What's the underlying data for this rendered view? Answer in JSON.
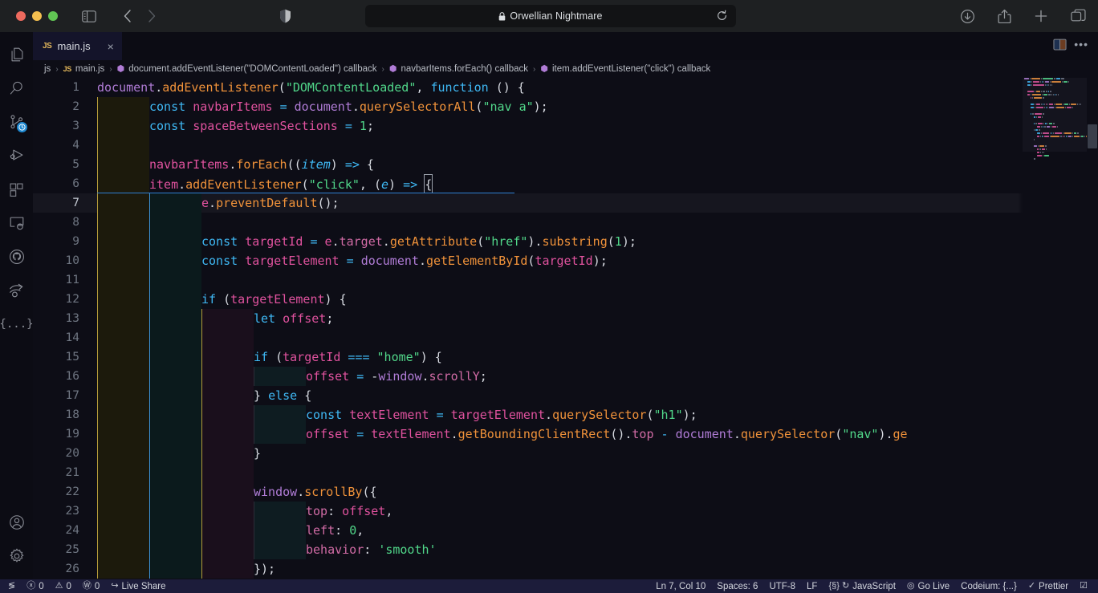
{
  "browser": {
    "title": "Orwellian Nightmare",
    "lock_icon": "lock-icon",
    "traffic_lights": [
      "close",
      "minimize",
      "zoom"
    ],
    "toolbar": {
      "sidebar": "sidebar-toggle-icon",
      "back": "chevron-left-icon",
      "forward": "chevron-right-icon",
      "shield": "privacy-shield-icon",
      "reload": "reload-icon",
      "downloads": "download-icon",
      "share": "share-icon",
      "new_tab": "plus-icon",
      "tab_overview": "tabs-icon"
    }
  },
  "activity_bar": {
    "items": [
      {
        "name": "explorer-icon",
        "label": "Explorer"
      },
      {
        "name": "search-icon",
        "label": "Search"
      },
      {
        "name": "source-control-icon",
        "label": "Source Control",
        "badge": "clock-badge"
      },
      {
        "name": "run-and-debug-icon",
        "label": "Run and Debug"
      },
      {
        "name": "extensions-icon",
        "label": "Extensions"
      },
      {
        "name": "remote-explorer-icon",
        "label": "Remote Explorer"
      },
      {
        "name": "github-icon",
        "label": "GitHub"
      },
      {
        "name": "live-share-icon",
        "label": "Live Share"
      },
      {
        "name": "codeium-icon",
        "label": "{...}"
      }
    ],
    "bottom_items": [
      {
        "name": "account-icon",
        "label": "Accounts"
      },
      {
        "name": "settings-gear-icon",
        "label": "Manage"
      }
    ]
  },
  "tabs": [
    {
      "label": "main.js",
      "icon": "JS",
      "close": "×",
      "active": true
    }
  ],
  "editor_actions": {
    "split": "split-editor-icon",
    "more": "•••"
  },
  "breadcrumb": {
    "items": [
      {
        "label": "js",
        "icon": null
      },
      {
        "label": "main.js",
        "icon": "JS"
      },
      {
        "label": "document.addEventListener(\"DOMContentLoaded\") callback",
        "icon": "symbol"
      },
      {
        "label": "navbarItems.forEach() callback",
        "icon": "symbol"
      },
      {
        "label": "item.addEventListener(\"click\") callback",
        "icon": "symbol"
      }
    ],
    "separator": "›"
  },
  "code": {
    "language": "JavaScript",
    "current_line": 7,
    "lines": [
      {
        "n": 1,
        "indent": 0,
        "tokens": [
          [
            "t-obj",
            "document"
          ],
          [
            "t-punc",
            "."
          ],
          [
            "t-fn",
            "addEventListener"
          ],
          [
            "t-punc",
            "("
          ],
          [
            "t-str",
            "\"DOMContentLoaded\""
          ],
          [
            "t-punc",
            ", "
          ],
          [
            "t-kw",
            "function"
          ],
          [
            "t-punc",
            " () {"
          ]
        ]
      },
      {
        "n": 2,
        "indent": 1,
        "tokens": [
          [
            "t-kw",
            "const"
          ],
          [
            "t-punc",
            " "
          ],
          [
            "t-var",
            "navbarItems"
          ],
          [
            "t-punc",
            " "
          ],
          [
            "t-op",
            "="
          ],
          [
            "t-punc",
            " "
          ],
          [
            "t-obj",
            "document"
          ],
          [
            "t-punc",
            "."
          ],
          [
            "t-fn",
            "querySelectorAll"
          ],
          [
            "t-punc",
            "("
          ],
          [
            "t-str",
            "\"nav a\""
          ],
          [
            "t-punc",
            ");"
          ]
        ]
      },
      {
        "n": 3,
        "indent": 1,
        "tokens": [
          [
            "t-kw",
            "const"
          ],
          [
            "t-punc",
            " "
          ],
          [
            "t-var",
            "spaceBetweenSections"
          ],
          [
            "t-punc",
            " "
          ],
          [
            "t-op",
            "="
          ],
          [
            "t-punc",
            " "
          ],
          [
            "t-num",
            "1"
          ],
          [
            "t-punc",
            ";"
          ]
        ]
      },
      {
        "n": 4,
        "indent": 1,
        "tokens": []
      },
      {
        "n": 5,
        "indent": 1,
        "tokens": [
          [
            "t-var",
            "navbarItems"
          ],
          [
            "t-punc",
            "."
          ],
          [
            "t-fn",
            "forEach"
          ],
          [
            "t-punc",
            "(("
          ],
          [
            "t-par",
            "item"
          ],
          [
            "t-punc",
            ") "
          ],
          [
            "t-op",
            "=>"
          ],
          [
            "t-punc",
            " {"
          ]
        ]
      },
      {
        "n": 6,
        "indent": 1,
        "tokens": [
          [
            "t-var",
            "item"
          ],
          [
            "t-punc",
            "."
          ],
          [
            "t-fn",
            "addEventListener"
          ],
          [
            "t-punc",
            "("
          ],
          [
            "t-str",
            "\"click\""
          ],
          [
            "t-punc",
            ", ("
          ],
          [
            "t-par",
            "e"
          ],
          [
            "t-punc",
            ") "
          ],
          [
            "t-op",
            "=>"
          ],
          [
            "t-punc",
            " "
          ],
          [
            "t-cursor",
            "{"
          ]
        ]
      },
      {
        "n": 7,
        "indent": 2,
        "tokens": [
          [
            "t-var",
            "e"
          ],
          [
            "t-punc",
            "."
          ],
          [
            "t-fn",
            "preventDefault"
          ],
          [
            "t-punc",
            "();"
          ]
        ]
      },
      {
        "n": 8,
        "indent": 2,
        "tokens": []
      },
      {
        "n": 9,
        "indent": 2,
        "tokens": [
          [
            "t-kw",
            "const"
          ],
          [
            "t-punc",
            " "
          ],
          [
            "t-var",
            "targetId"
          ],
          [
            "t-punc",
            " "
          ],
          [
            "t-op",
            "="
          ],
          [
            "t-punc",
            " "
          ],
          [
            "t-var",
            "e"
          ],
          [
            "t-punc",
            "."
          ],
          [
            "t-prop",
            "target"
          ],
          [
            "t-punc",
            "."
          ],
          [
            "t-fn",
            "getAttribute"
          ],
          [
            "t-punc",
            "("
          ],
          [
            "t-str",
            "\"href\""
          ],
          [
            "t-punc",
            ")."
          ],
          [
            "t-fn",
            "substring"
          ],
          [
            "t-punc",
            "("
          ],
          [
            "t-num",
            "1"
          ],
          [
            "t-punc",
            ");"
          ]
        ]
      },
      {
        "n": 10,
        "indent": 2,
        "tokens": [
          [
            "t-kw",
            "const"
          ],
          [
            "t-punc",
            " "
          ],
          [
            "t-var",
            "targetElement"
          ],
          [
            "t-punc",
            " "
          ],
          [
            "t-op",
            "="
          ],
          [
            "t-punc",
            " "
          ],
          [
            "t-obj",
            "document"
          ],
          [
            "t-punc",
            "."
          ],
          [
            "t-fn",
            "getElementById"
          ],
          [
            "t-punc",
            "("
          ],
          [
            "t-var",
            "targetId"
          ],
          [
            "t-punc",
            ");"
          ]
        ]
      },
      {
        "n": 11,
        "indent": 2,
        "tokens": []
      },
      {
        "n": 12,
        "indent": 2,
        "tokens": [
          [
            "t-kw",
            "if"
          ],
          [
            "t-punc",
            " ("
          ],
          [
            "t-var",
            "targetElement"
          ],
          [
            "t-punc",
            ") {"
          ]
        ]
      },
      {
        "n": 13,
        "indent": 3,
        "tokens": [
          [
            "t-kw",
            "let"
          ],
          [
            "t-punc",
            " "
          ],
          [
            "t-var",
            "offset"
          ],
          [
            "t-punc",
            ";"
          ]
        ]
      },
      {
        "n": 14,
        "indent": 3,
        "tokens": []
      },
      {
        "n": 15,
        "indent": 3,
        "tokens": [
          [
            "t-kw",
            "if"
          ],
          [
            "t-punc",
            " ("
          ],
          [
            "t-var",
            "targetId"
          ],
          [
            "t-punc",
            " "
          ],
          [
            "t-op",
            "==="
          ],
          [
            "t-punc",
            " "
          ],
          [
            "t-str",
            "\"home\""
          ],
          [
            "t-punc",
            ") {"
          ]
        ]
      },
      {
        "n": 16,
        "indent": 4,
        "tokens": [
          [
            "t-var",
            "offset"
          ],
          [
            "t-punc",
            " "
          ],
          [
            "t-op",
            "="
          ],
          [
            "t-punc",
            " -"
          ],
          [
            "t-obj",
            "window"
          ],
          [
            "t-punc",
            "."
          ],
          [
            "t-prop",
            "scrollY"
          ],
          [
            "t-punc",
            ";"
          ]
        ]
      },
      {
        "n": 17,
        "indent": 3,
        "tokens": [
          [
            "t-punc",
            "} "
          ],
          [
            "t-kw",
            "else"
          ],
          [
            "t-punc",
            " {"
          ]
        ]
      },
      {
        "n": 18,
        "indent": 4,
        "tokens": [
          [
            "t-kw",
            "const"
          ],
          [
            "t-punc",
            " "
          ],
          [
            "t-var",
            "textElement"
          ],
          [
            "t-punc",
            " "
          ],
          [
            "t-op",
            "="
          ],
          [
            "t-punc",
            " "
          ],
          [
            "t-var",
            "targetElement"
          ],
          [
            "t-punc",
            "."
          ],
          [
            "t-fn",
            "querySelector"
          ],
          [
            "t-punc",
            "("
          ],
          [
            "t-str",
            "\"h1\""
          ],
          [
            "t-punc",
            ");"
          ]
        ]
      },
      {
        "n": 19,
        "indent": 4,
        "tokens": [
          [
            "t-var",
            "offset"
          ],
          [
            "t-punc",
            " "
          ],
          [
            "t-op",
            "="
          ],
          [
            "t-punc",
            " "
          ],
          [
            "t-var",
            "textElement"
          ],
          [
            "t-punc",
            "."
          ],
          [
            "t-fn",
            "getBoundingClientRect"
          ],
          [
            "t-punc",
            "()."
          ],
          [
            "t-prop",
            "top"
          ],
          [
            "t-punc",
            " "
          ],
          [
            "t-op",
            "-"
          ],
          [
            "t-punc",
            " "
          ],
          [
            "t-obj",
            "document"
          ],
          [
            "t-punc",
            "."
          ],
          [
            "t-fn",
            "querySelector"
          ],
          [
            "t-punc",
            "("
          ],
          [
            "t-str",
            "\"nav\""
          ],
          [
            "t-punc",
            ")."
          ],
          [
            "t-fn",
            "ge"
          ]
        ]
      },
      {
        "n": 20,
        "indent": 3,
        "tokens": [
          [
            "t-punc",
            "}"
          ]
        ]
      },
      {
        "n": 21,
        "indent": 3,
        "tokens": []
      },
      {
        "n": 22,
        "indent": 3,
        "tokens": [
          [
            "t-obj",
            "window"
          ],
          [
            "t-punc",
            "."
          ],
          [
            "t-fn",
            "scrollBy"
          ],
          [
            "t-punc",
            "({"
          ]
        ]
      },
      {
        "n": 23,
        "indent": 4,
        "tokens": [
          [
            "t-prop",
            "top"
          ],
          [
            "t-punc",
            ": "
          ],
          [
            "t-var",
            "offset"
          ],
          [
            "t-punc",
            ","
          ]
        ]
      },
      {
        "n": 24,
        "indent": 4,
        "tokens": [
          [
            "t-prop",
            "left"
          ],
          [
            "t-punc",
            ": "
          ],
          [
            "t-num",
            "0"
          ],
          [
            "t-punc",
            ","
          ]
        ]
      },
      {
        "n": 25,
        "indent": 4,
        "tokens": [
          [
            "t-prop",
            "behavior"
          ],
          [
            "t-punc",
            ": "
          ],
          [
            "t-str",
            "'smooth'"
          ]
        ]
      },
      {
        "n": 26,
        "indent": 3,
        "tokens": [
          [
            "t-punc",
            "});"
          ]
        ]
      }
    ],
    "overflow_right_char": "g"
  },
  "status_bar": {
    "left": [
      {
        "name": "remote-window-indicator",
        "icon": "≶",
        "label": ""
      },
      {
        "name": "problems-errors",
        "icon": "ⓧ",
        "label": "0"
      },
      {
        "name": "problems-warnings",
        "icon": "⚠",
        "label": "0"
      },
      {
        "name": "ports-forwarded",
        "icon": "Ⓦ",
        "label": "0"
      },
      {
        "name": "live-share",
        "icon": "↪",
        "label": "Live Share"
      }
    ],
    "right": [
      {
        "name": "editor-position",
        "icon": "",
        "label": "Ln 7, Col 10"
      },
      {
        "name": "editor-indentation",
        "icon": "",
        "label": "Spaces: 6"
      },
      {
        "name": "editor-encoding",
        "icon": "",
        "label": "UTF-8"
      },
      {
        "name": "editor-eol",
        "icon": "",
        "label": "LF"
      },
      {
        "name": "editor-language",
        "icon": "{§} ↻",
        "label": "JavaScript"
      },
      {
        "name": "go-live",
        "icon": "◎",
        "label": "Go Live"
      },
      {
        "name": "codeium-status",
        "icon": "",
        "label": "Codeium: {...}"
      },
      {
        "name": "prettier-status",
        "icon": "✓",
        "label": "Prettier"
      },
      {
        "name": "notifications-bell",
        "icon": "☑",
        "label": ""
      }
    ]
  },
  "colors": {
    "editor_bg": "#0d0d16",
    "chrome_bg": "#1e2022",
    "status_bg": "#1c1c3a",
    "accent_blue": "#3fb9f5",
    "string_green": "#51d88a",
    "method_orange": "#f0923a",
    "var_pink": "#e0529e",
    "object_purple": "#b07cd6"
  }
}
